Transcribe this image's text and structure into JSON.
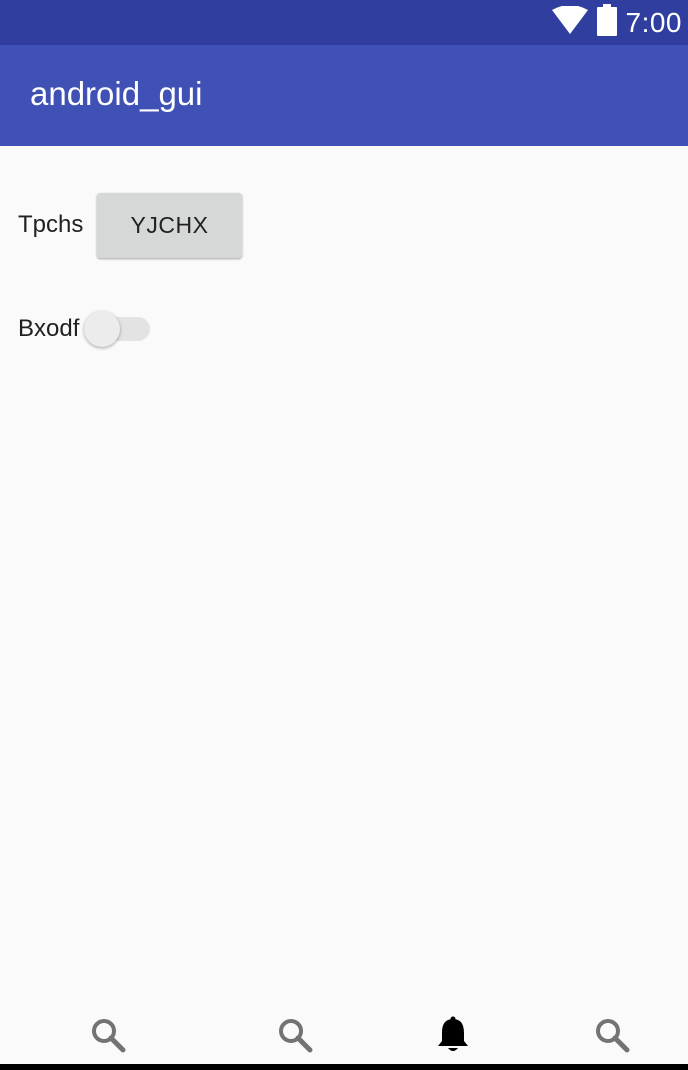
{
  "status_bar": {
    "time": "7:00",
    "icons": [
      "wifi-icon",
      "battery-icon"
    ]
  },
  "app_bar": {
    "title": "android_gui"
  },
  "form": {
    "button_row": {
      "label": "Tpchs",
      "button_label": "YJCHX"
    },
    "switch_row": {
      "label": "Bxodf",
      "checked": false
    }
  },
  "bottom_nav": {
    "items": [
      {
        "icon": "search-icon",
        "selected": false
      },
      {
        "icon": "search-icon",
        "selected": false
      },
      {
        "icon": "bell-icon",
        "selected": true
      },
      {
        "icon": "search-icon",
        "selected": false
      }
    ]
  },
  "colors": {
    "status_bar": "#303F9F",
    "app_bar": "#3F51B5",
    "background": "#FAFAFA",
    "button": "#D6D7D7",
    "nav_inactive": "#737373",
    "nav_active": "#000000"
  }
}
